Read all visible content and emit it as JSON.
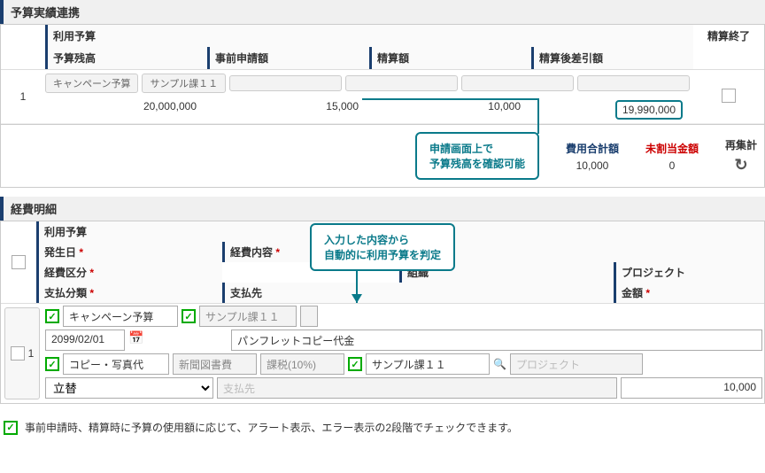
{
  "budget_section": {
    "title": "予算実績連携",
    "headers": {
      "usage": "利用予算",
      "balance": "予算残高",
      "pre_request": "事前申請額",
      "settlement": "精算額",
      "after_diff": "精算後差引額",
      "settle_end": "精算終了"
    },
    "row": {
      "num": "1",
      "budget_name": "キャンペーン予算",
      "dept": "サンプル課１１",
      "balance": "20,000,000",
      "pre_request": "15,000",
      "settlement": "10,000",
      "after_diff": "19,990,000"
    },
    "callout1_line1": "申請画面上で",
    "callout1_line2": "予算残高を確認可能",
    "summary": {
      "total_label": "費用合計額",
      "total_value": "10,000",
      "unalloc_label": "未割当金額",
      "unalloc_value": "0",
      "recalc_label": "再集計"
    }
  },
  "detail_section": {
    "title": "経費明細",
    "callout2_line1": "入力した内容から",
    "callout2_line2": "自動的に利用予算を判定",
    "headers": {
      "usage": "利用予算",
      "date": "発生日",
      "content": "経費内容",
      "category": "経費区分",
      "org": "組織",
      "project": "プロジェクト",
      "pay_class": "支払分類",
      "payee": "支払先",
      "amount": "金額"
    },
    "row": {
      "num": "1",
      "budget_name": "キャンペーン予算",
      "dept_ph": "サンプル課１１",
      "date": "2099/02/01",
      "content": "パンフレットコピー代金",
      "category": "コピー・写真代",
      "sub_cat": "新聞図書費",
      "tax": "課税(10%)",
      "org": "サンプル課１１",
      "project_ph": "プロジェクト",
      "pay_class": "立替",
      "payee_ph": "支払先",
      "amount": "10,000"
    }
  },
  "footer_note": "事前申請時、精算時に予算の使用額に応じて、アラート表示、エラー表示の2段階でチェックできます。"
}
